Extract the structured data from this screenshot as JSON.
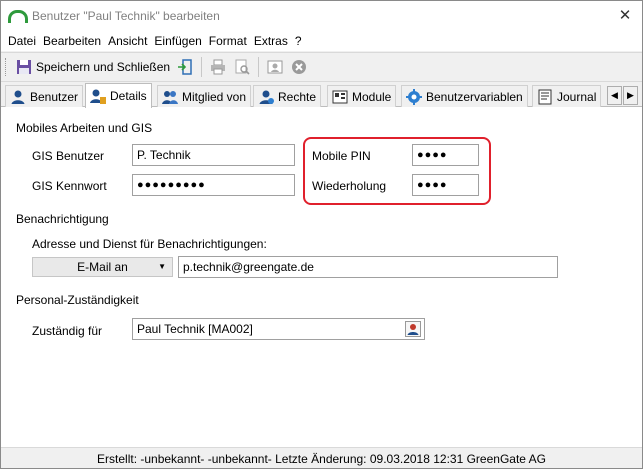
{
  "window": {
    "title": "Benutzer \"Paul Technik\" bearbeiten",
    "close_symbol": "✕"
  },
  "menu": [
    {
      "label": "Datei",
      "name": "menu-datei"
    },
    {
      "label": "Bearbeiten",
      "name": "menu-bearbeiten"
    },
    {
      "label": "Ansicht",
      "name": "menu-ansicht"
    },
    {
      "label": "Einfügen",
      "name": "menu-einfuegen"
    },
    {
      "label": "Format",
      "name": "menu-format"
    },
    {
      "label": "Extras",
      "name": "menu-extras"
    },
    {
      "label": "?",
      "name": "menu-help"
    }
  ],
  "toolbar": {
    "save_close_label": "Speichern und Schließen"
  },
  "tabs": [
    {
      "label": "Benutzer",
      "icon": "user-icon"
    },
    {
      "label": "Details",
      "icon": "user-details-icon",
      "active": true
    },
    {
      "label": "Mitglied von",
      "icon": "group-icon"
    },
    {
      "label": "Rechte",
      "icon": "rights-icon"
    },
    {
      "label": "Module",
      "icon": "module-icon"
    },
    {
      "label": "Benutzervariablen",
      "icon": "variables-icon"
    },
    {
      "label": "Journal",
      "icon": "journal-icon"
    }
  ],
  "mobile": {
    "title": "Mobiles Arbeiten und GIS",
    "gis_user_label": "GIS Benutzer",
    "gis_user_value": "P. Technik",
    "gis_password_label": "GIS Kennwort",
    "gis_password_value": "●●●●●●●●●",
    "pin_label": "Mobile PIN",
    "pin_value": "●●●●",
    "repeat_label": "Wiederholung",
    "repeat_value": "●●●●"
  },
  "notification": {
    "title": "Benachrichtigung",
    "description": "Adresse und Dienst für Benachrichtigungen:",
    "service_value": "E-Mail an",
    "address_value": "p.technik@greengate.de"
  },
  "responsibility": {
    "title": "Personal-Zuständigkeit",
    "label": "Zuständig für",
    "value": "Paul Technik [MA002]"
  },
  "status": {
    "text": "Erstellt: -unbekannt- -unbekannt-  Letzte Änderung: 09.03.2018 12:31 GreenGate AG"
  },
  "colors": {
    "highlight": "#e0202c",
    "brand_green": "#2e9a3c"
  }
}
